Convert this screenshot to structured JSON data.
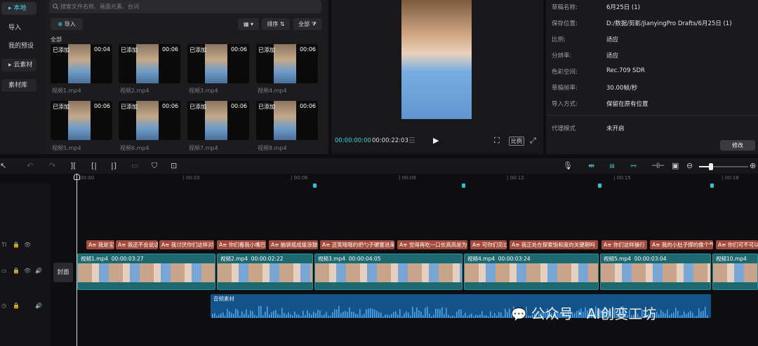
{
  "sidebar": {
    "items": [
      {
        "label": "▸ 本地",
        "active": true
      },
      {
        "label": "导入"
      },
      {
        "label": "我的预设"
      },
      {
        "label": "▸ 云素材"
      },
      {
        "label": "素材库"
      }
    ]
  },
  "media": {
    "search_placeholder": "搜索文件名称、画面元素、台词",
    "import_label": "导入",
    "sort_label": "排序",
    "all_label": "全部",
    "section_label": "全部",
    "items": [
      {
        "name": "视频1.mp4",
        "added": "已添加",
        "duration": "00:04"
      },
      {
        "name": "视频2.mp4",
        "added": "已添加",
        "duration": "00:06"
      },
      {
        "name": "视频3.mp4",
        "added": "已添加",
        "duration": "00:06"
      },
      {
        "name": "视频4.mp4",
        "added": "已添加",
        "duration": "00:06"
      },
      {
        "name": "视频5.mp4",
        "added": "已添加",
        "duration": "00:06"
      },
      {
        "name": "视频6.mp4",
        "added": "已添加",
        "duration": "00:06"
      },
      {
        "name": "视频7.mp4",
        "added": "已添加",
        "duration": "00:06"
      },
      {
        "name": "视频8.mp4",
        "added": "已添加",
        "duration": "00:06"
      }
    ]
  },
  "preview": {
    "current_time": "00:00:00:00",
    "total_time": "00:00:22:03",
    "ratio_label": "比例"
  },
  "props": {
    "rows": [
      {
        "label": "草稿名称:",
        "value": "6月25日 (1)"
      },
      {
        "label": "保存位置:",
        "value": "D:/数据/剪影/JianyingPro Drafts/6月25日 (1)"
      },
      {
        "label": "比例:",
        "value": "适应"
      },
      {
        "label": "分辨率:",
        "value": "适应"
      },
      {
        "label": "色彩空间:",
        "value": "Rec.709 SDR"
      },
      {
        "label": "草稿帧率:",
        "value": "30.00帧/秒"
      },
      {
        "label": "导入方式:",
        "value": "保留在原有位置"
      }
    ],
    "proxy_label": "代理模式",
    "proxy_value": "未开启",
    "modify_label": "修改"
  },
  "ruler": {
    "ticks": [
      "00:00",
      "| 00:03",
      "| 00:06",
      "| 00:09",
      "| 00:12",
      "| 00:15",
      "| 00:18"
    ]
  },
  "timeline": {
    "cover_label": "封面",
    "subtitles": [
      "A≡ 我是宝",
      "A≡ 我还不会说话",
      "A≡ 我讨厌你们这样对我",
      "A≡ 你们看我小嘴巴",
      "A≡ 脑袋摇成拨浪鼓",
      "A≡ 还笑嘻嘻的把勺子硬塞进来",
      "A≡ 觉得再吃一口长高高是为你",
      "A≡ 可你们见过",
      "A≡ 我正处在探索饱和度的关键期吗",
      "A≡ 你们这样操行",
      "A≡ 我的小肚子撑的像个气球",
      "A≡ 你们可不可以"
    ],
    "video_clips": [
      {
        "name": "视频1.mp4",
        "time": "00:00:03:27"
      },
      {
        "name": "视频2.mp4",
        "time": "00:00:02:22"
      },
      {
        "name": "视频3.mp4",
        "time": "00:00:04:05"
      },
      {
        "name": "视频4.mp4",
        "time": "00:00:03:24"
      },
      {
        "name": "视频5.mp4",
        "time": "00:00:03:04"
      },
      {
        "name": "视频10.mp4",
        "time": ""
      }
    ],
    "audio_label": "音频素材"
  },
  "watermark": "公众号 · AI创变工坊"
}
